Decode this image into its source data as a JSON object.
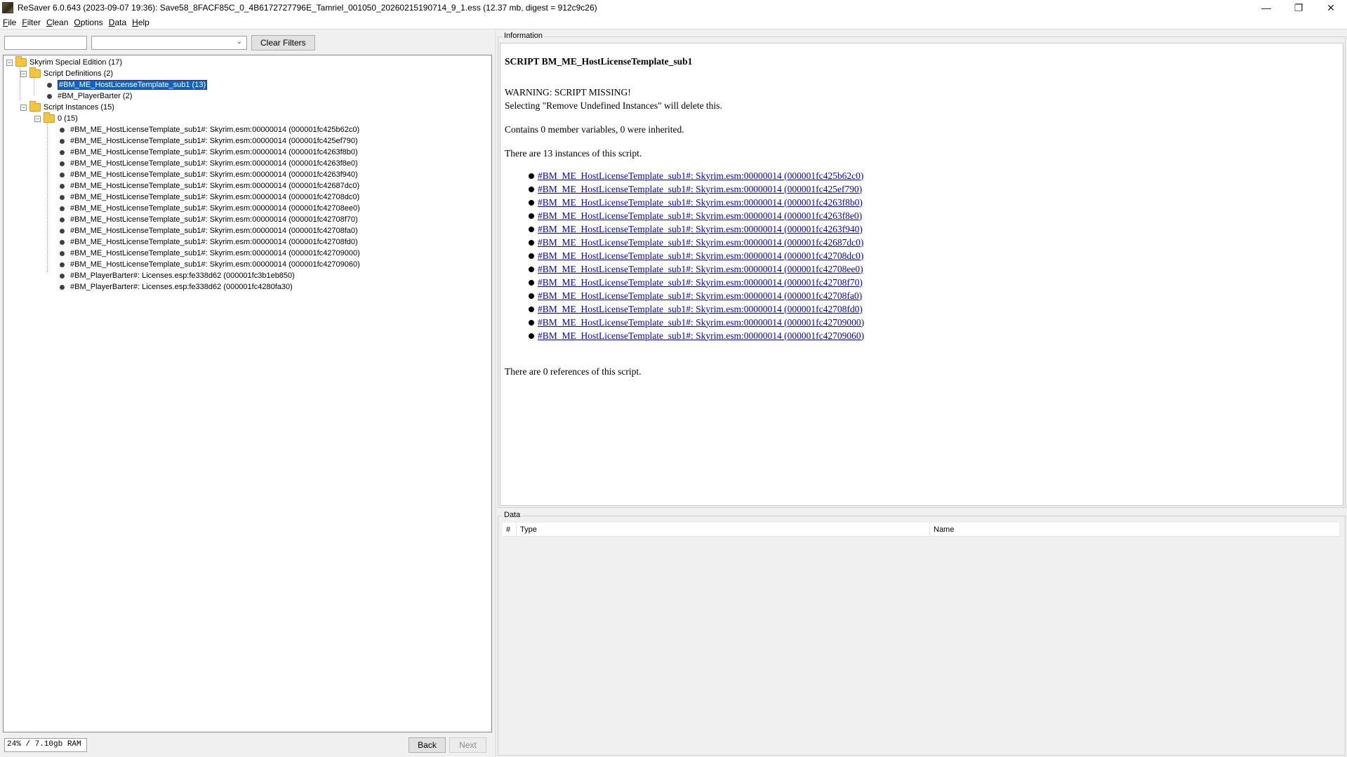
{
  "window": {
    "title": "ReSaver 6.0.643 (2023-09-07 19:36): Save58_8FACF85C_0_4B6172727796E_Tamriel_001050_20260215190714_9_1.ess (12.37 mb, digest = 912c9c26)",
    "minimize_glyph": "—",
    "maximize_glyph": "❐",
    "close_glyph": "✕"
  },
  "menu": {
    "file": {
      "u": "F",
      "rest": "ile"
    },
    "filter": {
      "u": "F",
      "rest": "ilter"
    },
    "clean": {
      "u": "C",
      "rest": "lean"
    },
    "options": {
      "u": "O",
      "rest": "ptions"
    },
    "data": {
      "u": "D",
      "rest": "ata"
    },
    "help": {
      "u": "H",
      "rest": "elp"
    }
  },
  "filter": {
    "text_value": "",
    "select_value": "",
    "clear_label": "Clear Filters"
  },
  "tree": {
    "root": "Skyrim Special Edition (17)",
    "script_definitions": "Script Definitions (2)",
    "definitions": [
      "#BM_ME_HostLicenseTemplate_sub1 (13)",
      "#BM_PlayerBarter (2)"
    ],
    "script_instances": "Script Instances (15)",
    "instances_group": "0 (15)",
    "instances": [
      "#BM_ME_HostLicenseTemplate_sub1#: Skyrim.esm:00000014 (000001fc425b62c0)",
      "#BM_ME_HostLicenseTemplate_sub1#: Skyrim.esm:00000014 (000001fc425ef790)",
      "#BM_ME_HostLicenseTemplate_sub1#: Skyrim.esm:00000014 (000001fc4263f8b0)",
      "#BM_ME_HostLicenseTemplate_sub1#: Skyrim.esm:00000014 (000001fc4263f8e0)",
      "#BM_ME_HostLicenseTemplate_sub1#: Skyrim.esm:00000014 (000001fc4263f940)",
      "#BM_ME_HostLicenseTemplate_sub1#: Skyrim.esm:00000014 (000001fc42687dc0)",
      "#BM_ME_HostLicenseTemplate_sub1#: Skyrim.esm:00000014 (000001fc42708dc0)",
      "#BM_ME_HostLicenseTemplate_sub1#: Skyrim.esm:00000014 (000001fc42708ee0)",
      "#BM_ME_HostLicenseTemplate_sub1#: Skyrim.esm:00000014 (000001fc42708f70)",
      "#BM_ME_HostLicenseTemplate_sub1#: Skyrim.esm:00000014 (000001fc42708fa0)",
      "#BM_ME_HostLicenseTemplate_sub1#: Skyrim.esm:00000014 (000001fc42708fd0)",
      "#BM_ME_HostLicenseTemplate_sub1#: Skyrim.esm:00000014 (000001fc42709000)",
      "#BM_ME_HostLicenseTemplate_sub1#: Skyrim.esm:00000014 (000001fc42709060)",
      "#BM_PlayerBarter#: Licenses.esp:fe338d62 (000001fc3b1eb850)",
      "#BM_PlayerBarter#: Licenses.esp:fe338d62 (000001fc4280fa30)"
    ]
  },
  "status": {
    "ram": "24% / 7.10gb RAM",
    "back_label": "Back",
    "next_label": "Next"
  },
  "info": {
    "group_label": "Information",
    "title": "SCRIPT BM_ME_HostLicenseTemplate_sub1",
    "warning": "WARNING: SCRIPT MISSING!",
    "remove_note": "Selecting \"Remove Undefined Instances\" will delete this.",
    "members": "Contains 0 member variables, 0 were inherited.",
    "instance_count": "There are 13 instances of this script.",
    "instance_links": [
      "#BM_ME_HostLicenseTemplate_sub1#: Skyrim.esm:00000014 (000001fc425b62c0)",
      "#BM_ME_HostLicenseTemplate_sub1#: Skyrim.esm:00000014 (000001fc425ef790)",
      "#BM_ME_HostLicenseTemplate_sub1#: Skyrim.esm:00000014 (000001fc4263f8b0)",
      "#BM_ME_HostLicenseTemplate_sub1#: Skyrim.esm:00000014 (000001fc4263f8e0)",
      "#BM_ME_HostLicenseTemplate_sub1#: Skyrim.esm:00000014 (000001fc4263f940)",
      "#BM_ME_HostLicenseTemplate_sub1#: Skyrim.esm:00000014 (000001fc42687dc0)",
      "#BM_ME_HostLicenseTemplate_sub1#: Skyrim.esm:00000014 (000001fc42708dc0)",
      "#BM_ME_HostLicenseTemplate_sub1#: Skyrim.esm:00000014 (000001fc42708ee0)",
      "#BM_ME_HostLicenseTemplate_sub1#: Skyrim.esm:00000014 (000001fc42708f70)",
      "#BM_ME_HostLicenseTemplate_sub1#: Skyrim.esm:00000014 (000001fc42708fa0)",
      "#BM_ME_HostLicenseTemplate_sub1#: Skyrim.esm:00000014 (000001fc42708fd0)",
      "#BM_ME_HostLicenseTemplate_sub1#: Skyrim.esm:00000014 (000001fc42709000)",
      "#BM_ME_HostLicenseTemplate_sub1#: Skyrim.esm:00000014 (000001fc42709060)"
    ],
    "references": "There are 0 references of this script."
  },
  "data_panel": {
    "group_label": "Data",
    "columns": [
      "#",
      "Type",
      "Name"
    ]
  },
  "colors": {
    "selection": "#0a64c8",
    "link": "#0000ee",
    "folder": "#f7c440"
  }
}
